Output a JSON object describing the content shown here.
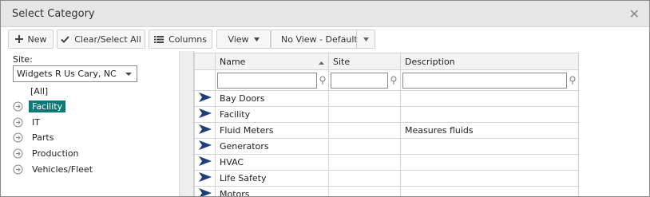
{
  "dialog": {
    "title": "Select Category"
  },
  "toolbar": {
    "new_label": "New",
    "clear_select_label": "Clear/Select All",
    "columns_label": "Columns",
    "view_label": "View",
    "view_select_value": "No View - Default"
  },
  "left": {
    "site_label": "Site:",
    "site_value": "Widgets R Us Cary, NC",
    "tree": {
      "all_label": "[All]",
      "items": [
        {
          "label": "Facility",
          "selected": true
        },
        {
          "label": "IT"
        },
        {
          "label": "Parts"
        },
        {
          "label": "Production"
        },
        {
          "label": "Vehicles/Fleet"
        }
      ]
    }
  },
  "grid": {
    "columns": [
      "Name",
      "Site",
      "Description"
    ],
    "rows": [
      {
        "name": "Bay Doors",
        "site": "",
        "description": ""
      },
      {
        "name": "Facility",
        "site": "",
        "description": ""
      },
      {
        "name": "Fluid Meters",
        "site": "",
        "description": "Measures fluids"
      },
      {
        "name": "Generators",
        "site": "",
        "description": ""
      },
      {
        "name": "HVAC",
        "site": "",
        "description": ""
      },
      {
        "name": "Life Safety",
        "site": "",
        "description": ""
      },
      {
        "name": "Motors",
        "site": "",
        "description": ""
      }
    ]
  },
  "icons": {
    "close": "close-icon",
    "new": "plus-icon",
    "clear_select": "checkmark-icon",
    "columns": "list-icon",
    "view": "caret-down-icon",
    "filter": "filter-icon",
    "select_row": "arrow-right-icon",
    "expander": "circle-arrow-icon"
  },
  "colors": {
    "selected_tree_bg": "#0c7a74",
    "row_arrow": "#1c3f7a",
    "titlebar_bg": "#e6e6e6"
  }
}
